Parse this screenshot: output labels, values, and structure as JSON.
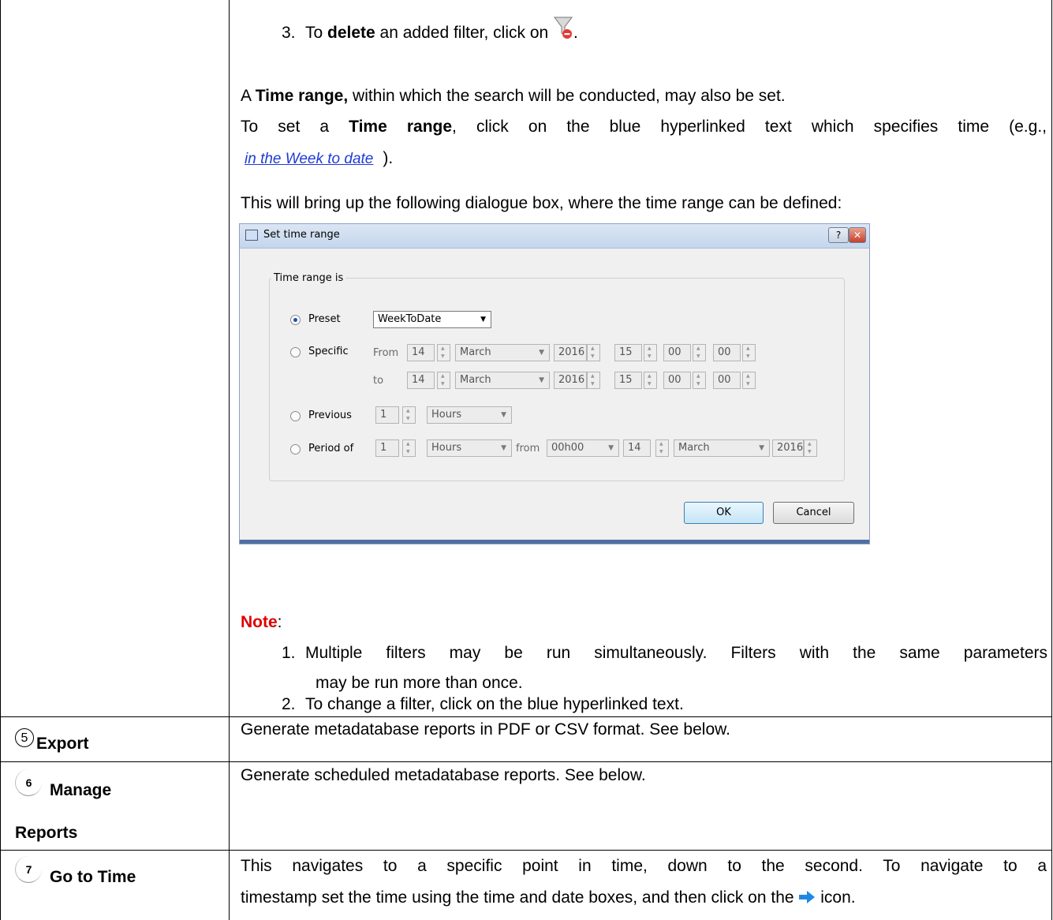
{
  "top": {
    "item3_num": "3.",
    "item3_pre": "To ",
    "item3_bold": "delete",
    "item3_post": " an added filter, click on ",
    "item3_end": ".",
    "p1_pre": "A ",
    "p1_bold": "Time range,",
    "p1_post": " within which the search will be conducted, may also be set.",
    "p2_pre": "To set a ",
    "p2_bold": "Time range",
    "p2_post": ", click on the blue hyperlinked text which specifies time (e.g.,",
    "p2_link": "in the Week to date",
    "p2_close": ").",
    "p3": "This will bring up the following dialogue box, where the time range can be defined:"
  },
  "dialog": {
    "title": "Set time range",
    "help_label": "?",
    "close_label": "✕",
    "group_label": "Time range is",
    "preset_label": "Preset",
    "preset_value": "WeekToDate",
    "specific_label": "Specific",
    "from_label": "From",
    "to_label": "to",
    "from_day": "14",
    "from_month": "March",
    "from_year": "2016",
    "from_hour": "15",
    "from_min": "00",
    "from_sec": "00",
    "to_day": "14",
    "to_month": "March",
    "to_year": "2016",
    "to_hour": "15",
    "to_min": "00",
    "to_sec": "00",
    "previous_label": "Previous",
    "previous_value": "1",
    "previous_unit": "Hours",
    "period_label": "Period of",
    "period_value": "1",
    "period_unit": "Hours",
    "period_from_label": "from",
    "period_time": "00h00",
    "period_day": "14",
    "period_month": "March",
    "period_year": "2016",
    "ok_label": "OK",
    "cancel_label": "Cancel"
  },
  "note": {
    "label": "Note",
    "colon": ":",
    "item1_num": "1.",
    "item1_line1": "Multiple filters may be run simultaneously. Filters with the same parameters",
    "item1_line2": "may be run more than once.",
    "item2_num": "2.",
    "item2": "To change a filter, click on the blue hyperlinked text."
  },
  "rows": {
    "export_marker": "5",
    "export_label": "Export",
    "export_desc": "Generate metadatabase reports in PDF or CSV format. See below.",
    "manage_marker": "6",
    "manage_label_1": "Manage",
    "manage_label_2": "Reports",
    "manage_desc": "Generate scheduled metadatabase reports. See below.",
    "goto_marker": "7",
    "goto_label": "Go to Time",
    "goto_desc_1": "This navigates to a specific point in time, down to the second. To navigate to a",
    "goto_desc_2_pre": "timestamp set the time using the time and date boxes, and then click on the",
    "goto_desc_2_post": " icon."
  },
  "colors": {
    "note": "#e00000",
    "link": "#1f3bd6",
    "arrow_icon": "#1e88e5"
  },
  "icons": {
    "delete_filter": "funnel-delete-icon",
    "go_arrow": "right-arrow-icon",
    "dialog": "clock-dialog-icon"
  }
}
